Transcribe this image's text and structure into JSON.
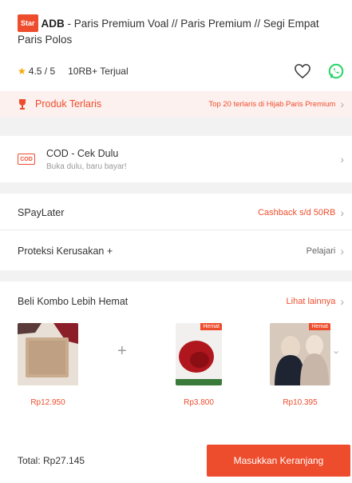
{
  "product": {
    "badge": "Star",
    "brand": "ADB",
    "title_rest": " - Paris Premium Voal // Paris Premium // Segi Empat Paris Polos",
    "rating": "4.5 / 5",
    "sold": "10RB+ Terjual"
  },
  "top_product": {
    "label": "Produk Terlaris",
    "description": "Top 20 terlaris di Hijab Paris Premium"
  },
  "cod": {
    "title": "COD - Cek Dulu",
    "subtitle": "Buka dulu, baru bayar!",
    "icon_text": "COD"
  },
  "spaylater": {
    "label": "SPayLater",
    "value": "Cashback s/d 50RB"
  },
  "protection": {
    "label": "Proteksi Kerusakan +",
    "link": "Pelajari"
  },
  "combo": {
    "title": "Beli Kombo Lebih Hemat",
    "link": "Lihat lainnya",
    "hemat_label": "Hemat",
    "items": [
      {
        "price": "Rp12.950"
      },
      {
        "price": "Rp3.800"
      },
      {
        "price": "Rp10.395"
      }
    ]
  },
  "footer": {
    "total": "Total: Rp27.145",
    "button": "Masukkan Keranjang"
  },
  "colors": {
    "accent": "#ee4d2d",
    "banner_bg": "#fdf1ef",
    "whatsapp": "#25d366"
  }
}
